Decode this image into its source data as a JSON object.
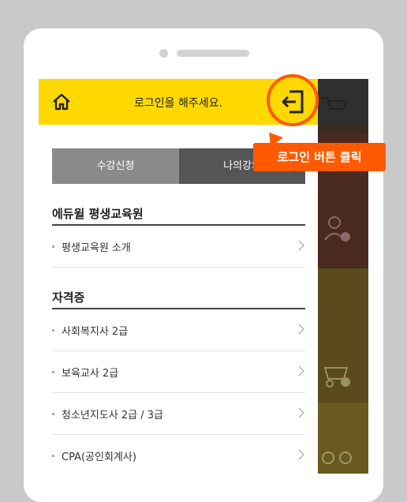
{
  "header": {
    "login_prompt": "로그인을 해주세요."
  },
  "tabs": [
    {
      "label": "수강신청"
    },
    {
      "label": "나의강의"
    }
  ],
  "sections": [
    {
      "title": "에듀윌 평생교육원",
      "items": [
        {
          "label": "평생교육원 소개"
        }
      ]
    },
    {
      "title": "자격증",
      "items": [
        {
          "label": "사회복지사 2급"
        },
        {
          "label": "보육교사 2급"
        },
        {
          "label": "청소년지도사 2급 / 3급"
        },
        {
          "label": "CPA(공인회계사)"
        }
      ]
    }
  ],
  "callout": {
    "text": "로그인 버튼 클릭"
  },
  "colors": {
    "accent_yellow": "#ffd800",
    "highlight_orange": "#ff5a00",
    "tab_active": "#8a8a8a",
    "tab_inactive": "#555555"
  },
  "icons": {
    "home": "home-icon",
    "login": "login-icon",
    "close": "close-icon",
    "cart": "cart-icon",
    "chevron": "chevron-right-icon"
  }
}
